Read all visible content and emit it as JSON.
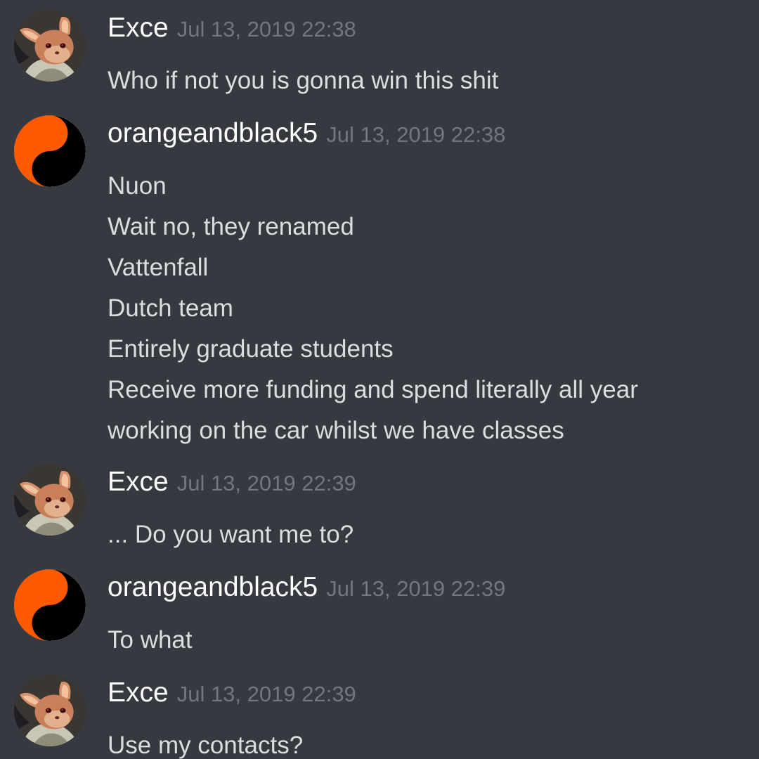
{
  "colors": {
    "background": "#36393f",
    "username": "#ffffff",
    "timestamp": "#72767d",
    "message_text": "#dcddde",
    "yin_yang_orange": "#ff5a00",
    "yin_yang_black": "#000000"
  },
  "messages": [
    {
      "author": "Exce",
      "avatar_icon": "fox-character-avatar-icon",
      "timestamp": "Jul 13, 2019 22:38",
      "lines": [
        "Who if not you is gonna win this shit"
      ]
    },
    {
      "author": "orangeandblack5",
      "avatar_icon": "yin-yang-avatar-icon",
      "timestamp": "Jul 13, 2019 22:38",
      "lines": [
        "Nuon",
        "Wait no, they renamed",
        "Vattenfall",
        "Dutch team",
        "Entirely graduate students",
        "Receive more funding and spend literally all year",
        "working on the car whilst we have classes"
      ]
    },
    {
      "author": "Exce",
      "avatar_icon": "fox-character-avatar-icon",
      "timestamp": "Jul 13, 2019 22:39",
      "lines": [
        "... Do you want me to?"
      ]
    },
    {
      "author": "orangeandblack5",
      "avatar_icon": "yin-yang-avatar-icon",
      "timestamp": "Jul 13, 2019 22:39",
      "lines": [
        "To what"
      ]
    },
    {
      "author": "Exce",
      "avatar_icon": "fox-character-avatar-icon",
      "timestamp": "Jul 13, 2019 22:39",
      "lines": [
        "Use my contacts?"
      ]
    }
  ]
}
